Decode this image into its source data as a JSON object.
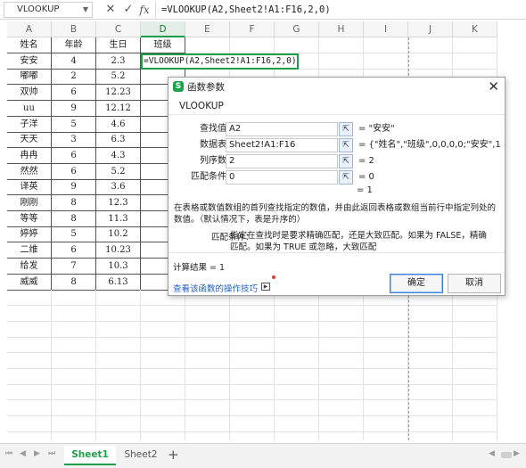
{
  "formula_bar": {
    "name_box": "VLOOKUP",
    "formula": "=VLOOKUP(A2,Sheet2!A1:F16,2,0)",
    "cancel_icon": "close-icon",
    "confirm_icon": "check-icon",
    "fx_icon": "fx-icon"
  },
  "columns": [
    "A",
    "B",
    "C",
    "D",
    "E",
    "F",
    "G",
    "H",
    "I",
    "J",
    "K"
  ],
  "active_column": "D",
  "table": {
    "headers": [
      "姓名",
      "年龄",
      "生日",
      "班级"
    ],
    "rows": [
      [
        "安安",
        "4",
        "2.3"
      ],
      [
        "嘟嘟",
        "2",
        "5.2"
      ],
      [
        "双帅",
        "6",
        "12.23"
      ],
      [
        "uu",
        "9",
        "12.12"
      ],
      [
        "子洋",
        "5",
        "4.6"
      ],
      [
        "天天",
        "3",
        "6.3"
      ],
      [
        "冉冉",
        "6",
        "4.3"
      ],
      [
        "然然",
        "6",
        "5.2"
      ],
      [
        "译英",
        "9",
        "3.6"
      ],
      [
        "刚刚",
        "8",
        "12.3"
      ],
      [
        "等等",
        "8",
        "11.3"
      ],
      [
        "婷婷",
        "5",
        "10.2"
      ],
      [
        "二维",
        "6",
        "10.23"
      ],
      [
        "给发",
        "7",
        "10.3"
      ],
      [
        "威威",
        "8",
        "6.13"
      ]
    ],
    "active_cell_text": "=VLOOKUP(A2,Sheet2!A1:F16,2,0)"
  },
  "dialog": {
    "title": "函数参数",
    "function_name": "VLOOKUP",
    "args": [
      {
        "label": "查找值",
        "value": "A2",
        "result": "= \"安安\""
      },
      {
        "label": "数据表",
        "value": "Sheet2!A1:F16",
        "result": "= {\"姓名\",\"班级\",0,0,0,0;\"安安\",1,..."
      },
      {
        "label": "列序数",
        "value": "2",
        "result": "= 2"
      },
      {
        "label": "匹配条件",
        "value": "0",
        "result": "= 0"
      }
    ],
    "overall_result": "= 1",
    "description": "在表格或数值数组的首列查找指定的数值，并由此返回表格或数组当前行中指定列处的数值。（默认情况下，表是升序的）",
    "param_label": "匹配条件：",
    "param_description": "指定在查找时是要求精确匹配，还是大致匹配。如果为 FALSE，精确匹配。如果为 TRUE 或忽略，大致匹配",
    "calc_result": "计算结果 = 1",
    "tips_link": "查看该函数的操作技巧",
    "ok_label": "确定",
    "cancel_label": "取消"
  },
  "tabs": {
    "sheets": [
      "Sheet1",
      "Sheet2"
    ],
    "active": "Sheet1",
    "add_label": "+"
  },
  "colors": {
    "accent_green": "#1e9e4a",
    "link_blue": "#1f5fbf"
  }
}
